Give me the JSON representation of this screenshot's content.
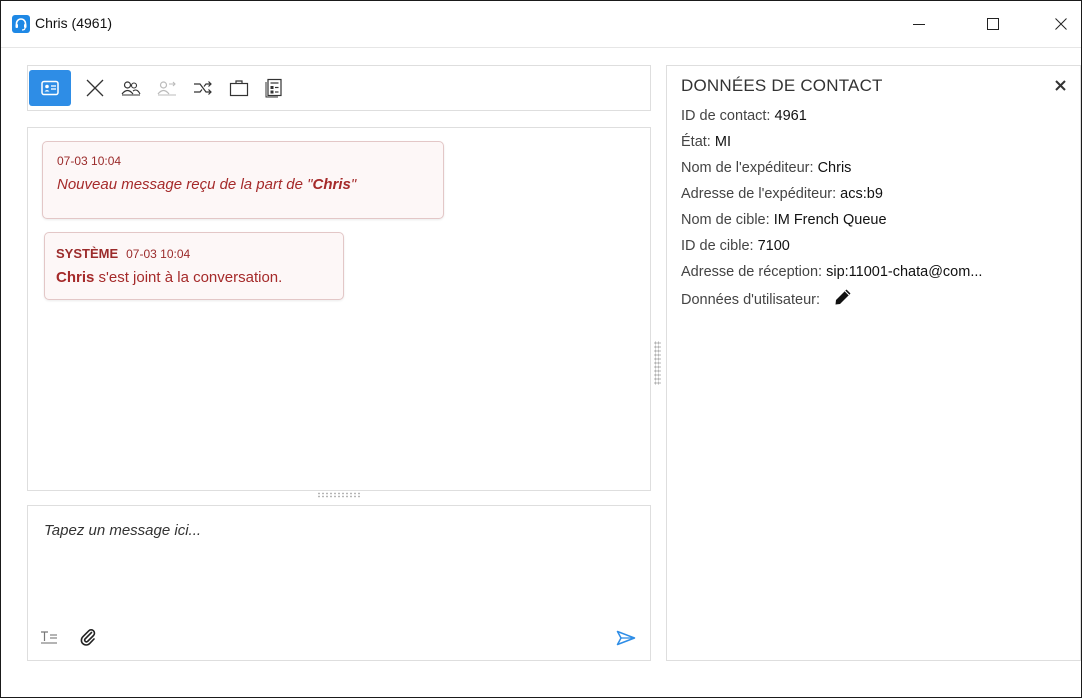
{
  "window": {
    "title": "Chris (4961)",
    "accent_color": "#1e88e5",
    "controls": {
      "minimize": "minimize-icon",
      "maximize": "maximize-icon",
      "close": "close-icon"
    }
  },
  "toolbar": {
    "tools": [
      {
        "name": "contact-card-icon",
        "active": true
      },
      {
        "name": "end-chat-icon"
      },
      {
        "name": "conference-icon"
      },
      {
        "name": "transfer-disabled-icon"
      },
      {
        "name": "forward-icon"
      },
      {
        "name": "case-icon"
      },
      {
        "name": "standard-responses-icon"
      }
    ]
  },
  "chat": {
    "messages": [
      {
        "time": "07-03 10:04",
        "text_prefix": "Nouveau message reçu de la part de ",
        "quote_open": "\"",
        "sender": "Chris",
        "quote_close": "\""
      },
      {
        "author": "SYSTÈME",
        "time": "07-03 10:04",
        "sender": "Chris",
        "text_suffix": " s'est joint à la conversation."
      }
    ]
  },
  "composer": {
    "placeholder": "Tapez un message ici...",
    "format_icon": "text-format-icon",
    "attach_icon": "paperclip-icon",
    "send_icon": "send-icon",
    "send_color": "#2e8de6"
  },
  "contact": {
    "title": "DONNÉES DE CONTACT",
    "fields": [
      {
        "label": "ID de contact:",
        "value": "4961"
      },
      {
        "label": "État:",
        "value": "MI"
      },
      {
        "label": "Nom de l'expéditeur:",
        "value": "Chris"
      },
      {
        "label": "Adresse de l'expéditeur:",
        "value": "acs:b9"
      },
      {
        "label": "Nom de cible:",
        "value": "IM French Queue"
      },
      {
        "label": "ID de cible:",
        "value": "7100"
      },
      {
        "label": "Adresse de réception:",
        "value": "sip:11001-chata@com..."
      },
      {
        "label": "Données d'utilisateur:"
      }
    ]
  },
  "colors": {
    "message_text": "#a52a2a",
    "bubble_bg": "#fdf7f7",
    "bubble_border": "#e3c7c7"
  }
}
